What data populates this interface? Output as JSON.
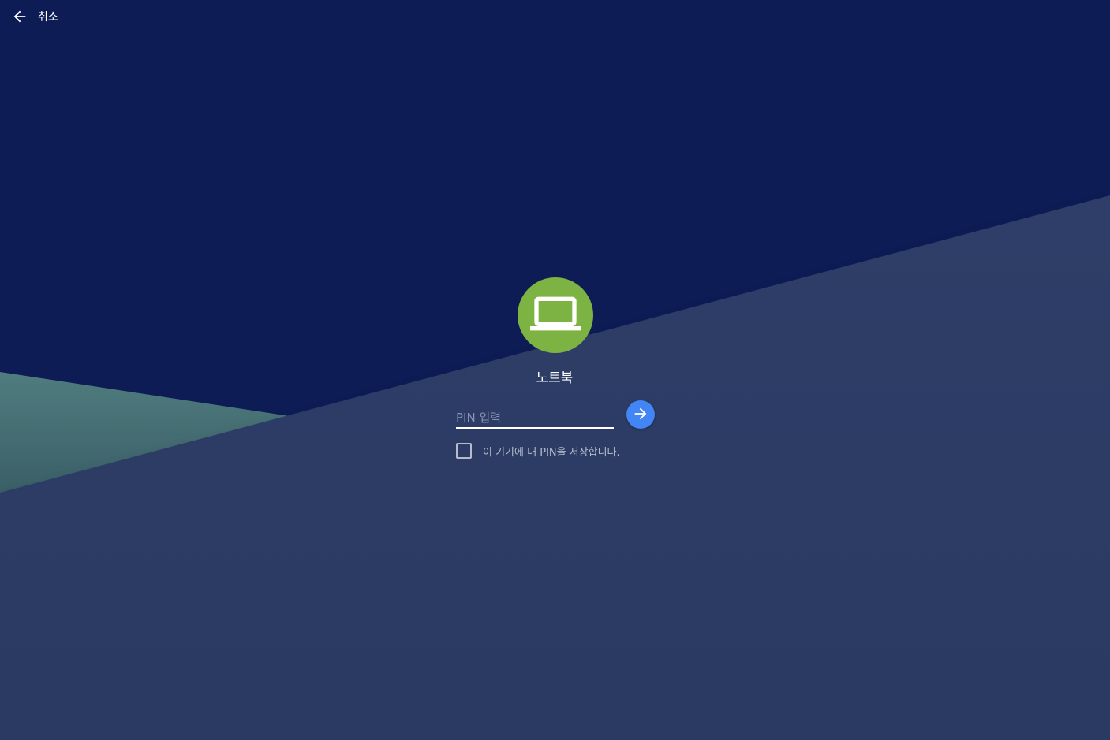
{
  "topbar": {
    "cancel_label": "취소",
    "icon": "arrow-back-icon"
  },
  "device": {
    "icon": "laptop-icon",
    "name": "노트북",
    "avatar_color": "#7cb342"
  },
  "pin": {
    "placeholder": "PIN 입력",
    "value": "",
    "submit_icon": "arrow-forward-icon",
    "submit_color": "#4285f4"
  },
  "save_pin": {
    "label": "이 기기에 내 PIN을 저장합니다.",
    "checked": false
  },
  "colors": {
    "background_dark": "#0d1c55",
    "background_slate": "#2b3b63",
    "background_teal": "#4d7a7c"
  }
}
